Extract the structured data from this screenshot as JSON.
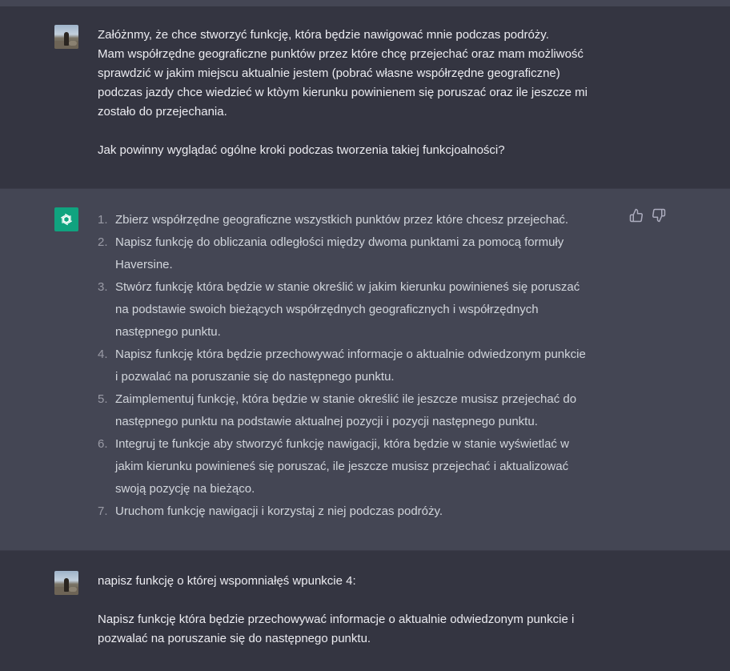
{
  "messages": [
    {
      "role": "user",
      "avatar_icon": "user-photo-avatar",
      "lines": [
        "Załóżnmy, że chce stworzyć funkcję, która będzie nawigować mnie podczas podróży.",
        "Mam współrzędne geograficzne punktów przez które chcę przejechać oraz mam możliwość",
        "sprawdzić w jakim miejscu aktualnie jestem (pobrać własne współrzędne geograficzne)",
        "podczas jazdy chce wiedzieć w ktòym kierunku powinienem się poruszać oraz ile jeszcze mi",
        "zostało do przejechania.",
        "",
        "Jak powinny wyglądać ogólne kroki podczas tworzenia takiej funkcjoalności?"
      ]
    },
    {
      "role": "assistant",
      "avatar_icon": "openai-logo-icon",
      "items": [
        {
          "n": "1.",
          "lines": [
            "Zbierz współrzędne geograficzne wszystkich punktów przez które chcesz przejechać."
          ]
        },
        {
          "n": "2.",
          "lines": [
            "Napisz funkcję do obliczania odległości między dwoma punktami za pomocą formuły",
            "Haversine."
          ]
        },
        {
          "n": "3.",
          "lines": [
            "Stwórz funkcję która będzie w stanie określić w jakim kierunku powinieneś się poruszać",
            "na podstawie swoich bieżących współrzędnych geograficznych i współrzędnych",
            "następnego punktu."
          ]
        },
        {
          "n": "4.",
          "lines": [
            "Napisz funkcję która będzie przechowywać informacje o aktualnie odwiedzonym punkcie",
            "i pozwalać na poruszanie się do następnego punktu."
          ]
        },
        {
          "n": "5.",
          "lines": [
            "Zaimplementuj funkcję, która będzie w stanie określić ile jeszcze musisz przejechać do",
            "następnego punktu na podstawie aktualnej pozycji i pozycji następnego punktu."
          ]
        },
        {
          "n": "6.",
          "lines": [
            "Integruj te funkcje aby stworzyć funkcję nawigacji, która będzie w stanie wyświetlać w",
            "jakim kierunku powinieneś się poruszać, ile jeszcze musisz przejechać i aktualizować",
            "swoją pozycję na bieżąco."
          ]
        },
        {
          "n": "7.",
          "lines": [
            "Uruchom funkcję nawigacji i korzystaj z niej podczas podróży."
          ]
        }
      ],
      "feedback": {
        "up_icon": "thumbs-up-icon",
        "down_icon": "thumbs-down-icon"
      }
    },
    {
      "role": "user",
      "avatar_icon": "user-photo-avatar",
      "lines": [
        "napisz funkcję o której wspomniałęś wpunkcie 4:",
        "",
        "Napisz funkcję która będzie przechowywać informacje o aktualnie odwiedzonym punkcie i",
        "pozwalać na poruszanie się do następnego punktu."
      ]
    }
  ]
}
